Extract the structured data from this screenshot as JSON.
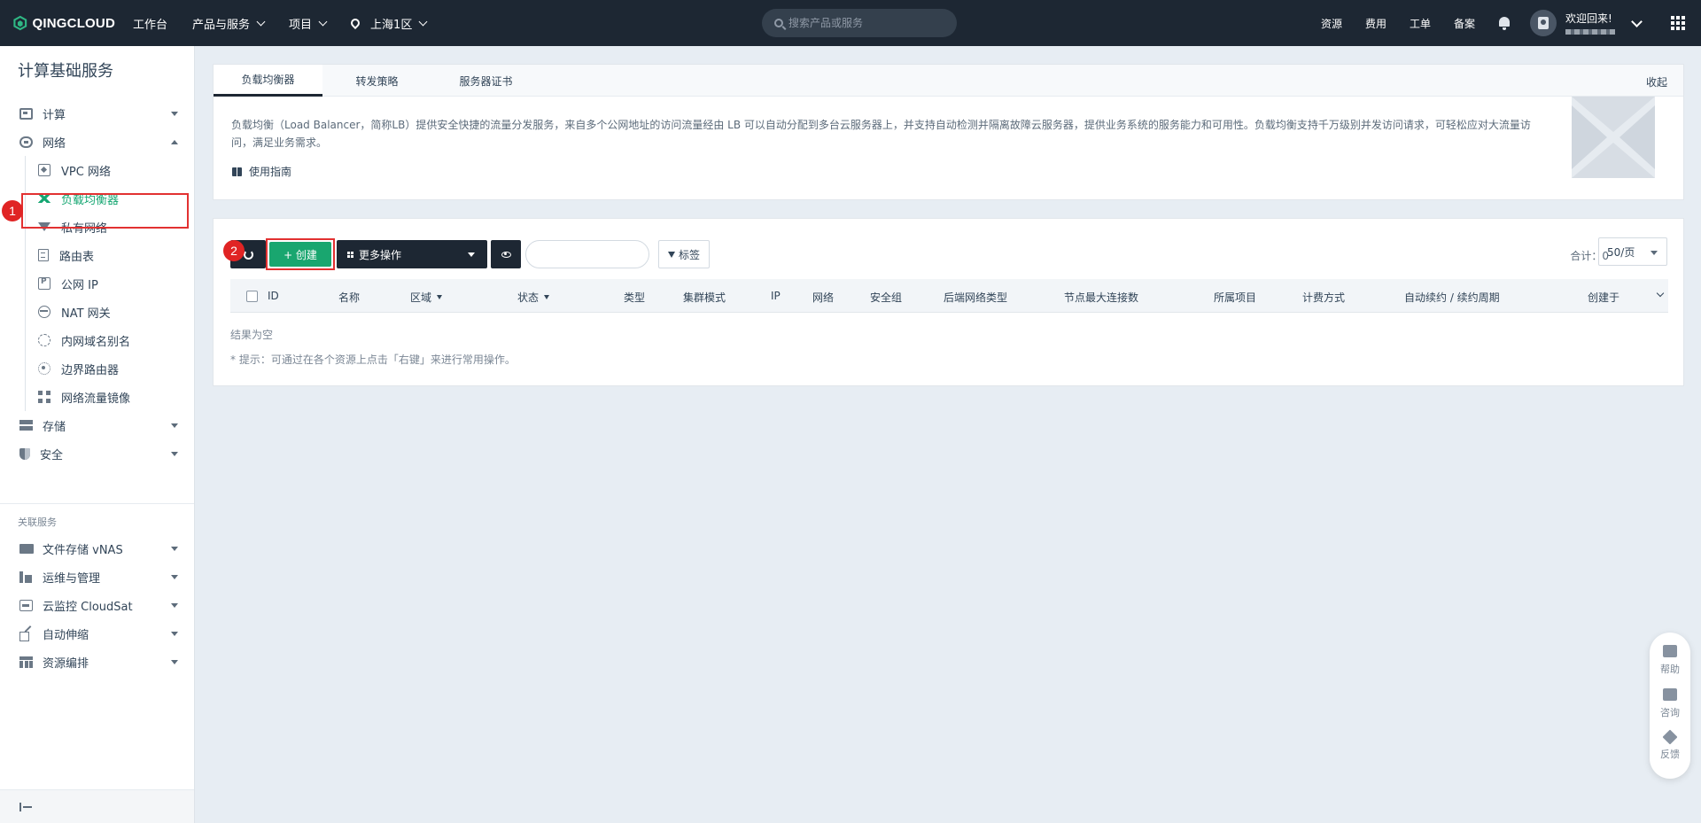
{
  "topbar": {
    "brand": "QINGCLOUD",
    "nav": [
      "工作台",
      "产品与服务",
      "项目"
    ],
    "region": "上海1区",
    "search_placeholder": "搜索产品或服务",
    "right_links": [
      "资源",
      "费用",
      "工单",
      "备案"
    ],
    "welcome": "欢迎回来!"
  },
  "sidebar": {
    "title": "计算基础服务",
    "groups": [
      {
        "label": "计算"
      },
      {
        "label": "网络"
      }
    ],
    "network_items": [
      "VPC 网络",
      "负载均衡器",
      "私有网络",
      "路由表",
      "公网 IP",
      "NAT 网关",
      "内网域名别名",
      "边界路由器",
      "网络流量镜像"
    ],
    "more_groups": [
      "存储",
      "安全"
    ],
    "related_title": "关联服务",
    "related": [
      "文件存储 vNAS",
      "运维与管理",
      "云监控 CloudSat",
      "自动伸缩",
      "资源编排"
    ]
  },
  "tabs": [
    "负载均衡器",
    "转发策略",
    "服务器证书"
  ],
  "collapse_label": "收起",
  "description": "负载均衡（Load Balancer，简称LB）提供安全快捷的流量分发服务，来自多个公网地址的访问流量经由 LB 可以自动分配到多台云服务器上，并支持自动检测并隔离故障云服务器，提供业务系统的服务能力和可用性。负载均衡支持千万级别并发访问请求，可轻松应对大流量访问，满足业务需求。",
  "guide_label": "使用指南",
  "toolbar": {
    "create_label": "+ 创建",
    "more_label": "更多操作",
    "tag_label": "标签",
    "total_label": "合计：0",
    "per_page": "50/页"
  },
  "table": {
    "headers": [
      "ID",
      "名称",
      "区域",
      "状态",
      "类型",
      "集群模式",
      "IP",
      "网络",
      "安全组",
      "后端网络类型",
      "节点最大连接数",
      "所属项目",
      "计费方式",
      "自动续约 / 续约周期",
      "创建于"
    ],
    "empty_text": "结果为空",
    "tip": "* 提示：可通过在各个资源上点击「右键」来进行常用操作。"
  },
  "annotations": [
    "1",
    "2"
  ],
  "float_tools": [
    "帮助",
    "咨询",
    "反馈"
  ]
}
